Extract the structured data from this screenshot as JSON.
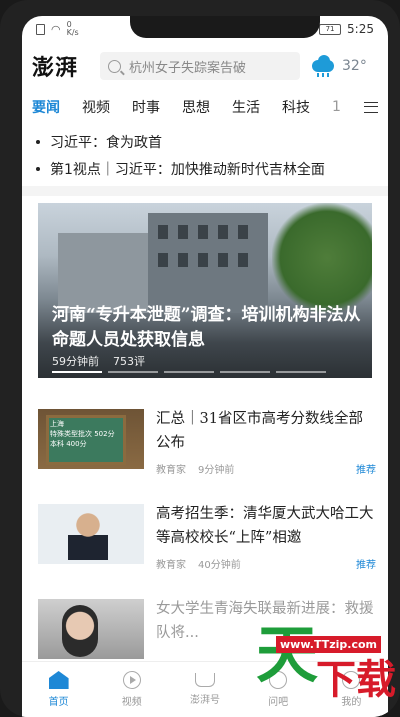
{
  "status_bar": {
    "netspeed_value": "0",
    "netspeed_unit": "K/s",
    "battery": "71",
    "time": "5:25"
  },
  "header": {
    "logo": "澎湃",
    "search_placeholder": "杭州女子失踪案告破",
    "temperature": "32°"
  },
  "tabs": [
    {
      "label": "要闻"
    },
    {
      "label": "视频"
    },
    {
      "label": "时事"
    },
    {
      "label": "思想"
    },
    {
      "label": "生活"
    },
    {
      "label": "科技"
    },
    {
      "label": "1"
    }
  ],
  "headlines": [
    {
      "text": "习近平：食为政首"
    },
    {
      "text": "第1视点｜习近平：加快推动新时代吉林全面"
    }
  ],
  "hero": {
    "title": "河南“专升本泄题”调查：培训机构非法从命题人员处获取信息",
    "time": "59分钟前",
    "comments": "753评"
  },
  "news": [
    {
      "title": "汇总｜31省区市高考分数线全部公布",
      "source": "教育家",
      "time": "9分钟前",
      "tag": "推荐",
      "thumb_text": "上海\n特殊类型批次 502分\n本科 400分"
    },
    {
      "title": "高考招生季：清华厦大武大哈工大等高校校长“上阵”相邀",
      "source": "教育家",
      "time": "40分钟前",
      "tag": "推荐"
    },
    {
      "title": "女大学生青海失联最新进展：救援队将...",
      "source": "",
      "time": "",
      "tag": ""
    }
  ],
  "bottom_nav": [
    {
      "label": "首页",
      "icon": "home-icon"
    },
    {
      "label": "视频",
      "icon": "video-icon"
    },
    {
      "label": "澎湃号",
      "icon": "ship-icon"
    },
    {
      "label": "问吧",
      "icon": "qa-icon"
    },
    {
      "label": "我的",
      "icon": "me-icon"
    }
  ],
  "watermark": {
    "big": "天",
    "small": "下载",
    "url": "www.TTzip.com"
  },
  "colors": {
    "accent": "#1e88d6",
    "watermark_green": "#1e9d3a",
    "watermark_red": "#d71b2a"
  }
}
